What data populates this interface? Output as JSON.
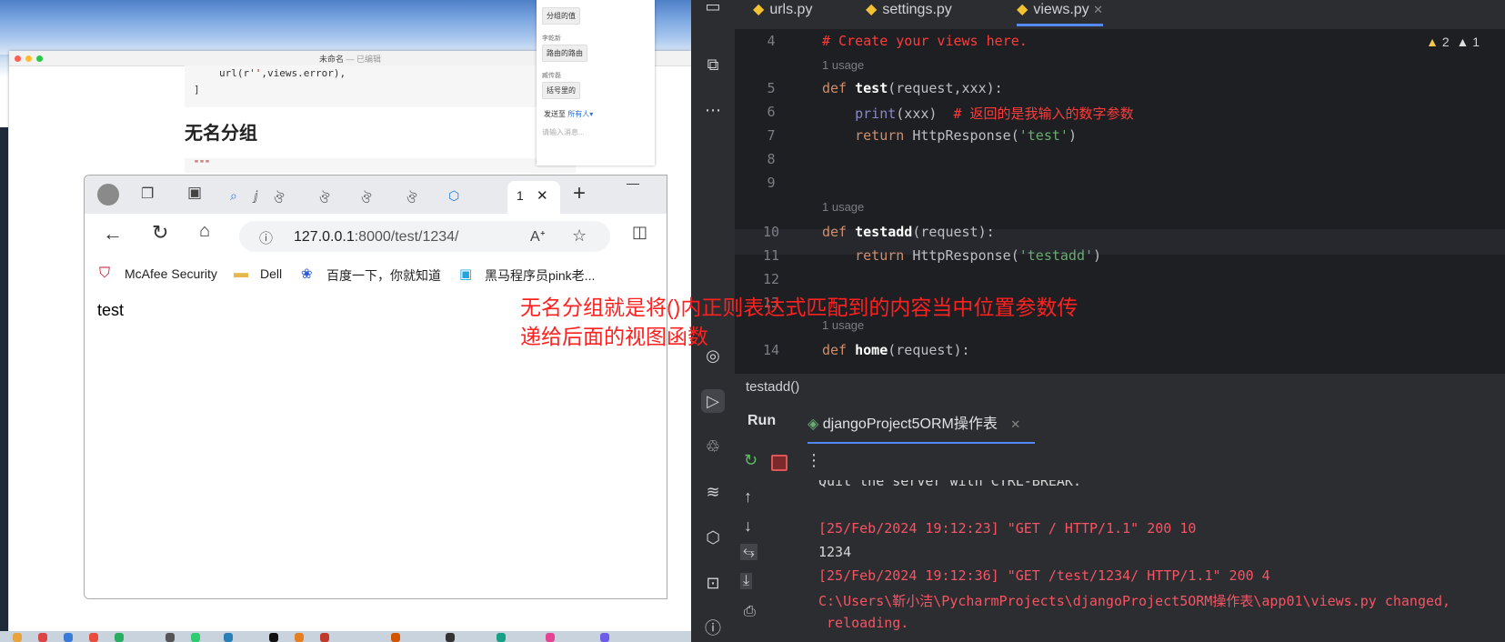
{
  "mac_doc": {
    "title": "未命名",
    "title_suffix": "— 已编辑",
    "code_line1_pre": "url(r",
    "code_line1_str": "''",
    "code_line1_post": ",views.error),",
    "code_line2": "]",
    "heading": "无名分组",
    "code2": "\"\"\""
  },
  "chat": {
    "msg1": "分组的值",
    "name2": "李乾新",
    "msg2": "路由的路由",
    "name3": "臧传磊",
    "msg3": "括号里的",
    "send_to_label": "发送至",
    "send_to_value": "所有人",
    "input_placeholder": "请输入消息..."
  },
  "browser": {
    "active_tab_label": "1",
    "address_host": "127.0.0.1",
    "address_path": ":8000/test/1234/",
    "bookmarks": [
      "McAfee Security",
      "Dell",
      "百度一下，你就知道",
      "黑马程序员pink老..."
    ],
    "page_text": "test"
  },
  "annotation": {
    "line1": "无名分组就是将()内正则表达式匹配到的内容当中位置参数传",
    "line2": "递给后面的视图函数"
  },
  "ide": {
    "tabs": [
      "urls.py",
      "settings.py",
      "views.py"
    ],
    "warnings": {
      "warn_count": "2",
      "weak_count": "1"
    },
    "usage_label": "1 usage",
    "lines": [
      {
        "n": "4",
        "text": "# Create your views here."
      },
      {
        "n": "5",
        "kw": "def",
        "name": "test",
        "args": "(request,xxx):"
      },
      {
        "n": "6",
        "call": "print",
        "args": "(xxx)",
        "comment": "# 返回的是我输入的数字参数"
      },
      {
        "n": "7",
        "kw": "return",
        "call": "HttpResponse",
        "str": "'test'"
      },
      {
        "n": "8"
      },
      {
        "n": "9"
      },
      {
        "n": "10",
        "kw": "def",
        "name": "testadd",
        "args": "(request):"
      },
      {
        "n": "11",
        "kw": "return",
        "call": "HttpResponse",
        "str": "'testadd'"
      },
      {
        "n": "12"
      },
      {
        "n": "13"
      },
      {
        "n": "14",
        "kw": "def",
        "name": "home",
        "args": "(request):"
      }
    ],
    "breadcrumb": "testadd()",
    "run_label": "Run",
    "run_config": "djangoProject5ORM操作表",
    "console": [
      {
        "cls": "green",
        "text": "Quit the server with CTRL-BREAK."
      },
      {
        "cls": "red",
        "text": "[25/Feb/2024 19:12:23] \"GET / HTTP/1.1\" 200 10"
      },
      {
        "cls": "green",
        "text": "1234"
      },
      {
        "cls": "red",
        "text": "[25/Feb/2024 19:12:36] \"GET /test/1234/ HTTP/1.1\" 200 4"
      },
      {
        "cls": "red",
        "text": "C:\\Users\\靳小洁\\PycharmProjects\\djangoProject5ORM操作表\\app01\\views.py changed,"
      },
      {
        "cls": "red",
        "text": " reloading."
      }
    ]
  }
}
